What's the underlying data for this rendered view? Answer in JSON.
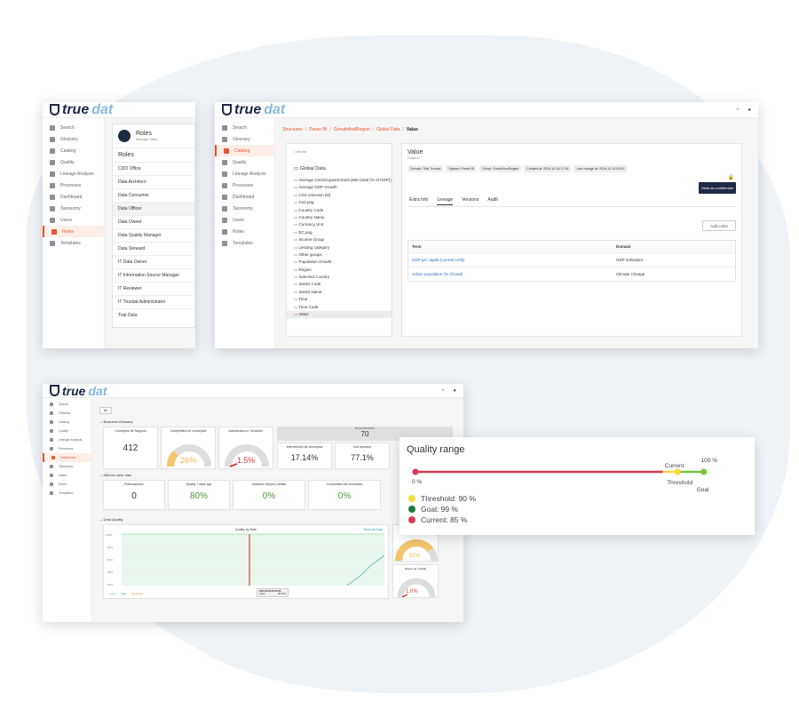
{
  "brand": {
    "true": "true",
    "dat": "dat"
  },
  "sidebar_items": [
    "Search",
    "Glossary",
    "Catalog",
    "Quality",
    "Lineage Analysis",
    "Processes",
    "Dashboard",
    "Taxonomy",
    "Users",
    "Roles",
    "Templates"
  ],
  "roles_window": {
    "header_title": "Roles",
    "header_subtitle": "Manage roles",
    "list_title": "Roles",
    "roles": [
      "CDO Office",
      "Data Architect",
      "Data Consumer",
      "Data Officer",
      "Data Owner",
      "Data Quality Manager",
      "Data Steward",
      "IT Data Owner",
      "IT Information Source Manager",
      "IT Reviewer",
      "IT Truedat Administrator",
      "Trial Data"
    ]
  },
  "catalog_window": {
    "breadcrumb": [
      "Structures",
      "Power BI",
      "GrowthAndRegion",
      "Global Data",
      "Value"
    ],
    "tree_home": "Home",
    "tree_root": "Global Data",
    "tree_items": [
      "Average Central government debt (total (% of GDP))",
      "Average GDP Growth",
      "CO2 emission (kt)",
      "Co2.png",
      "Country Code",
      "Country Name",
      "Currency Unit",
      "EC.png",
      "Income Group",
      "Lending category",
      "Other groups",
      "Population Growth",
      "Region",
      "Selected Country",
      "Series Code",
      "Series Name",
      "Time",
      "Time Code",
      "Value"
    ],
    "detail_title": "Value",
    "detail_subtitle": "Column",
    "chips": [
      "Domain: Trial Truedat",
      "System: Power BI",
      "Group: GrowthAndRegion",
      "Created at: 2019-10-18 17:18",
      "Last change at: 2019-10-18 00:00"
    ],
    "confidential_button": "Mark as confidential",
    "tabs": [
      "Extra Info",
      "Lineage",
      "Versions",
      "Audit"
    ],
    "add_links_button": "Add Links",
    "table_headers": [
      "Term",
      "Domain"
    ],
    "table_rows": [
      {
        "term": "GDP per capita (current US$)",
        "domain": "GDP indicators"
      },
      {
        "term": "Urban population (% of total)",
        "domain": "Climate Change"
      }
    ]
  },
  "dashboard_window": {
    "filter": "All",
    "section1": "Business Glossary",
    "stats1": [
      {
        "label": "Conceptos de Negocio",
        "value": "412"
      },
      {
        "label": "Completitud de conceptos",
        "value": "26%"
      },
      {
        "label": "Actualizados a 'Vencidos'",
        "value": "1.5%"
      }
    ],
    "no_publication_label": "No publicados",
    "no_publication_value": "70",
    "stats1b": [
      {
        "label": "Intervención de conceptos",
        "value": "17.14%"
      },
      {
        "label": "Con borrador",
        "value": "77.1%"
      }
    ],
    "section2": "Últimos siete días",
    "stats2": [
      {
        "label": "Publicaciones",
        "value": "0"
      },
      {
        "label": "Quality 7 days ago",
        "value": "80%"
      },
      {
        "label": "Variación Mejora Calidad",
        "value": "0%"
      },
      {
        "label": "Completitud de conceptos",
        "value": "0%"
      }
    ],
    "section3": "Data Quality",
    "chart_title": "Quality by Date",
    "chart_link": "Show All Data",
    "chart_yticks": [
      "100%",
      "80%",
      "60%",
      "40%",
      "20%"
    ],
    "right_gauges": [
      {
        "label": "",
        "value": "82%"
      },
      {
        "label": "Mejora de Calidad",
        "value": "1.0%"
      }
    ],
    "tooltip_title": "2019-09-08 00:00:00",
    "tooltip_rows": [
      {
        "name": "result",
        "value": "90.00%"
      },
      {
        "name": "goal",
        "value": "100.00%"
      },
      {
        "name": "threshold",
        "value": "100.00%"
      }
    ],
    "legend": [
      "result",
      "goal",
      "threshold"
    ]
  },
  "quality_range": {
    "title": "Quality range",
    "left_label": "0 %",
    "right_label": "100 %",
    "marker_current": "Current",
    "marker_threshold": "Threshold",
    "marker_goal": "Goal",
    "current": 85,
    "threshold": 90,
    "goal": 99,
    "legend": [
      {
        "text": "Threshold: 90 %",
        "color": "#f4dc3c"
      },
      {
        "text": "Goal: 99 %",
        "color": "#1e7a3a"
      },
      {
        "text": "Current: 85 %",
        "color": "#d63a5a"
      }
    ],
    "colors": {
      "red": "#d63a5a",
      "yellow": "#f4dc3c",
      "green": "#1e7a3a",
      "lime": "#7cc142"
    }
  }
}
